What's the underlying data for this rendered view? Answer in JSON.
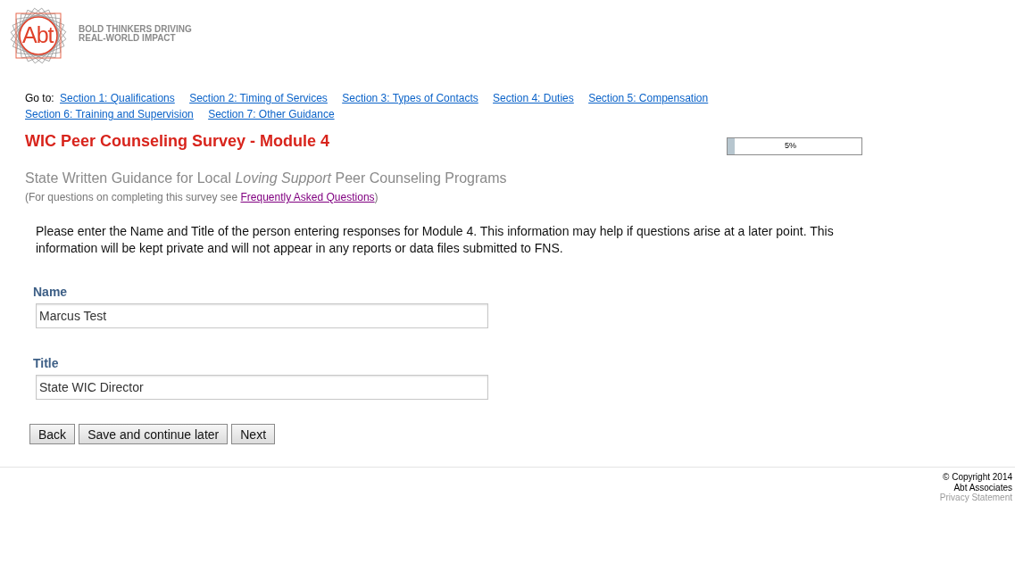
{
  "header": {
    "logo_text": "Abt",
    "tagline": [
      "BOLD THINKERS DRIVING",
      "REAL-WORLD IMPACT"
    ]
  },
  "navigation": {
    "label": "Go to:",
    "links": [
      {
        "label": "Section 1: Qualifications",
        "visited": false
      },
      {
        "label": "Section 2: Timing of Services",
        "visited": false
      },
      {
        "label": "Section 3: Types of Contacts",
        "visited": false
      },
      {
        "label": "Section 4: Duties",
        "visited": false
      },
      {
        "label": "Section 5: Compensation",
        "visited": false
      },
      {
        "label": "Section 6: Training and Supervision",
        "visited": false
      },
      {
        "label": "Section 7: Other Guidance",
        "visited": false
      }
    ]
  },
  "title": "WIC Peer Counseling Survey - Module 4",
  "progress": {
    "level": 0.05,
    "reading": "5%"
  },
  "subtitle": "State Written Guidance for Local *Loving Support* Peer Counseling Programs",
  "help": {
    "before": "(For questions on completing this survey see",
    "link": {
      "label": "Frequently Asked Questions",
      "visited": true
    },
    "after": ")"
  },
  "intro": "Please enter the Name and Title of the person entering responses for Module 4. This information may help if questions arise at a later point. This information will be kept private and will not appear in any reports or data files submitted to FNS.",
  "fields": [
    {
      "label": "Name",
      "value": "Marcus Test"
    },
    {
      "label": "Title",
      "value": "State WIC Director"
    }
  ],
  "buttons": [
    "Back",
    "Save and continue later",
    "Next"
  ],
  "footer": {
    "copyright": "© Copyright 2014",
    "company": "Abt Associates",
    "privacy_link": "Privacy Statement"
  }
}
